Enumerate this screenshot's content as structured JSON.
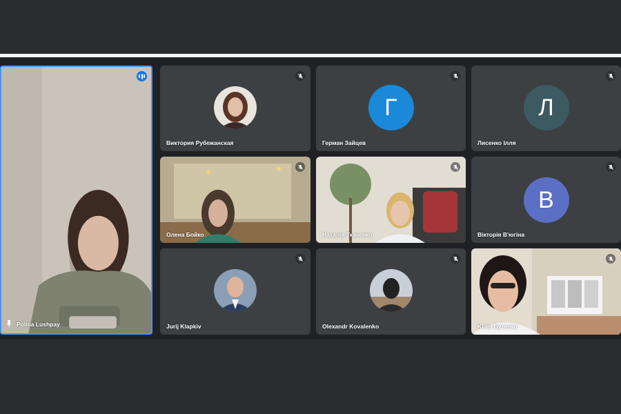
{
  "participants": {
    "main": {
      "name": "Polina Lushpay"
    },
    "tiles": [
      {
        "name": "Виктория Рубежанская"
      },
      {
        "name": "Герман Зайцев",
        "initial": "Г",
        "color": "#1a8ad8"
      },
      {
        "name": "Лисенко Ілля",
        "initial": "Л",
        "color": "#3d5a60"
      },
      {
        "name": "Олена Бойко"
      },
      {
        "name": "Наталія Ткаченко"
      },
      {
        "name": "Вікторія В'югіна",
        "initial": "В",
        "color": "#5b6fc5"
      },
      {
        "name": "Jurij Klapkiv"
      },
      {
        "name": "Olexandr Kovalenko"
      },
      {
        "name": "Юлія Бутенко"
      }
    ]
  },
  "icons": {
    "muted": "mic-off-icon",
    "speaking": "audio-level-icon",
    "pinned": "pin-icon"
  },
  "colors": {
    "background": "#202124",
    "tile": "#3c4043",
    "active_speaker_border": "#4d90fe"
  }
}
